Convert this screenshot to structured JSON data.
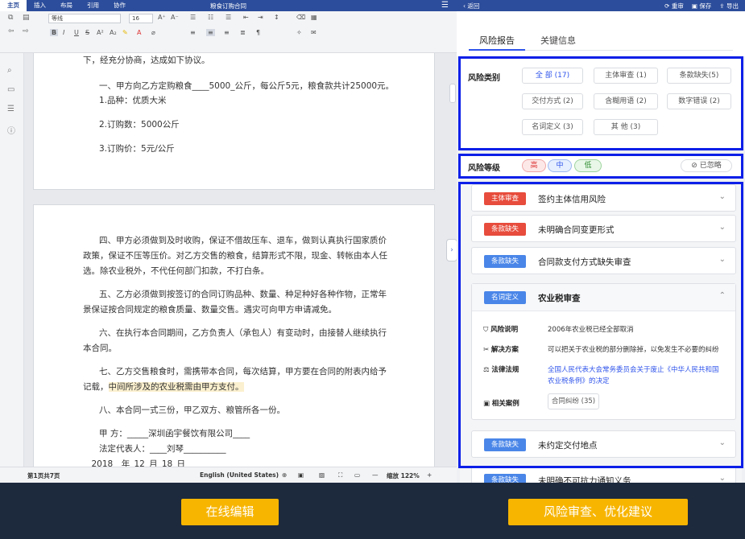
{
  "left": {
    "tabs": [
      "主页",
      "插入",
      "布局",
      "引用",
      "协作"
    ],
    "doc_title": "粮食订购合同",
    "toolbar": {
      "font": "等线",
      "size": "16"
    },
    "page1_lines": [
      "下，经充分协商，达成如下协议。",
      "一、甲方向乙方定购粮食____5000_公斤，每公斤5元，粮食款共计25000元。",
      "1.品种：优质大米",
      "2.订购数：5000公斤",
      "3.订购价：5元/公斤"
    ],
    "page2_lines": [
      "四、甲方必须做到及时收购，保证不借故压车、退车，做到认真执行国家质价",
      "政策，保证不压等压价。对乙方交售的粮食，结算形式不限，现金、转帐由本人任",
      "选。除农业税外，不代任何部门扣款，不打白条。",
      "五、乙方必须做到按签订的合同订购品种、数量、种足种好各种作物，正常年",
      "景保证按合同规定的粮食质量、数量交售。遇灾可向甲方申请减免。",
      "六、在执行本合同期间，乙方负责人（承包人）有变动时，由接替人继续执行",
      "本合同。",
      "七、乙方交售粮食时，需携带本合同，每次结算，甲方要在合同的附表内给予",
      "记载，",
      "中间所涉及的农业税需由甲方支付。",
      "八、本合同一式三份，甲乙双方、粮管所各一份。",
      "甲 方：_____深圳函宇餐饮有限公司____",
      "法定代表人：____刘琴__________",
      "__2018__年_12_月_18_日"
    ],
    "status": {
      "pages": "第1页共7页",
      "lang": "English (United States)",
      "zoom": "缩放 122%",
      "minus": "—",
      "plus": "+"
    }
  },
  "right": {
    "back": "返回",
    "actions": [
      "重审",
      "保存",
      "导出"
    ],
    "tabs": [
      "风险报告",
      "关键信息"
    ],
    "category_label": "风险类别",
    "categories": [
      "全 部 (17)",
      "主体审查 (1)",
      "条款缺失(5)",
      "交付方式 (2)",
      "含糊用语 (2)",
      "数字错误 (2)",
      "名词定义 (3)",
      "其 他 (3)"
    ],
    "level_label": "风险等级",
    "levels": [
      "高",
      "中",
      "低"
    ],
    "ignored": "已忽略",
    "items": [
      {
        "tag": "主体审查",
        "title": "签约主体信用风险"
      },
      {
        "tag": "条款缺失",
        "title": "未明确合同变更形式"
      },
      {
        "tag": "条款缺失",
        "title": "合同款支付方式缺失审查"
      },
      {
        "tag": "名词定义",
        "title": "农业税审查"
      },
      {
        "tag": "条款缺失",
        "title": "未约定交付地点"
      },
      {
        "tag": "条款缺失",
        "title": "未明确不可抗力通知义务"
      }
    ],
    "detail": {
      "desc_label": "风险说明",
      "desc": "2006年农业税已经全部取消",
      "sol_label": "解决方案",
      "sol": "可以把关于农业税的部分删除掉，以免发生不必要的纠纷",
      "law_label": "法律法规",
      "law1": "全国人民代表大会常务委员会关于废止《中华人民共和国",
      "law2": "农业税条例》的决定",
      "case_label": "相关案例",
      "case": "合同纠纷 (35)"
    }
  },
  "bottom": {
    "left_label": "在线编辑",
    "right_label": "风险审查、优化建议"
  },
  "colors": {
    "header": "#2c4d9b",
    "accent": "#2f54eb",
    "highlight_box": "#0c1fe8",
    "tag_red": "#e74c3c",
    "tag_blue": "#4a86e8",
    "button": "#f7b500"
  }
}
